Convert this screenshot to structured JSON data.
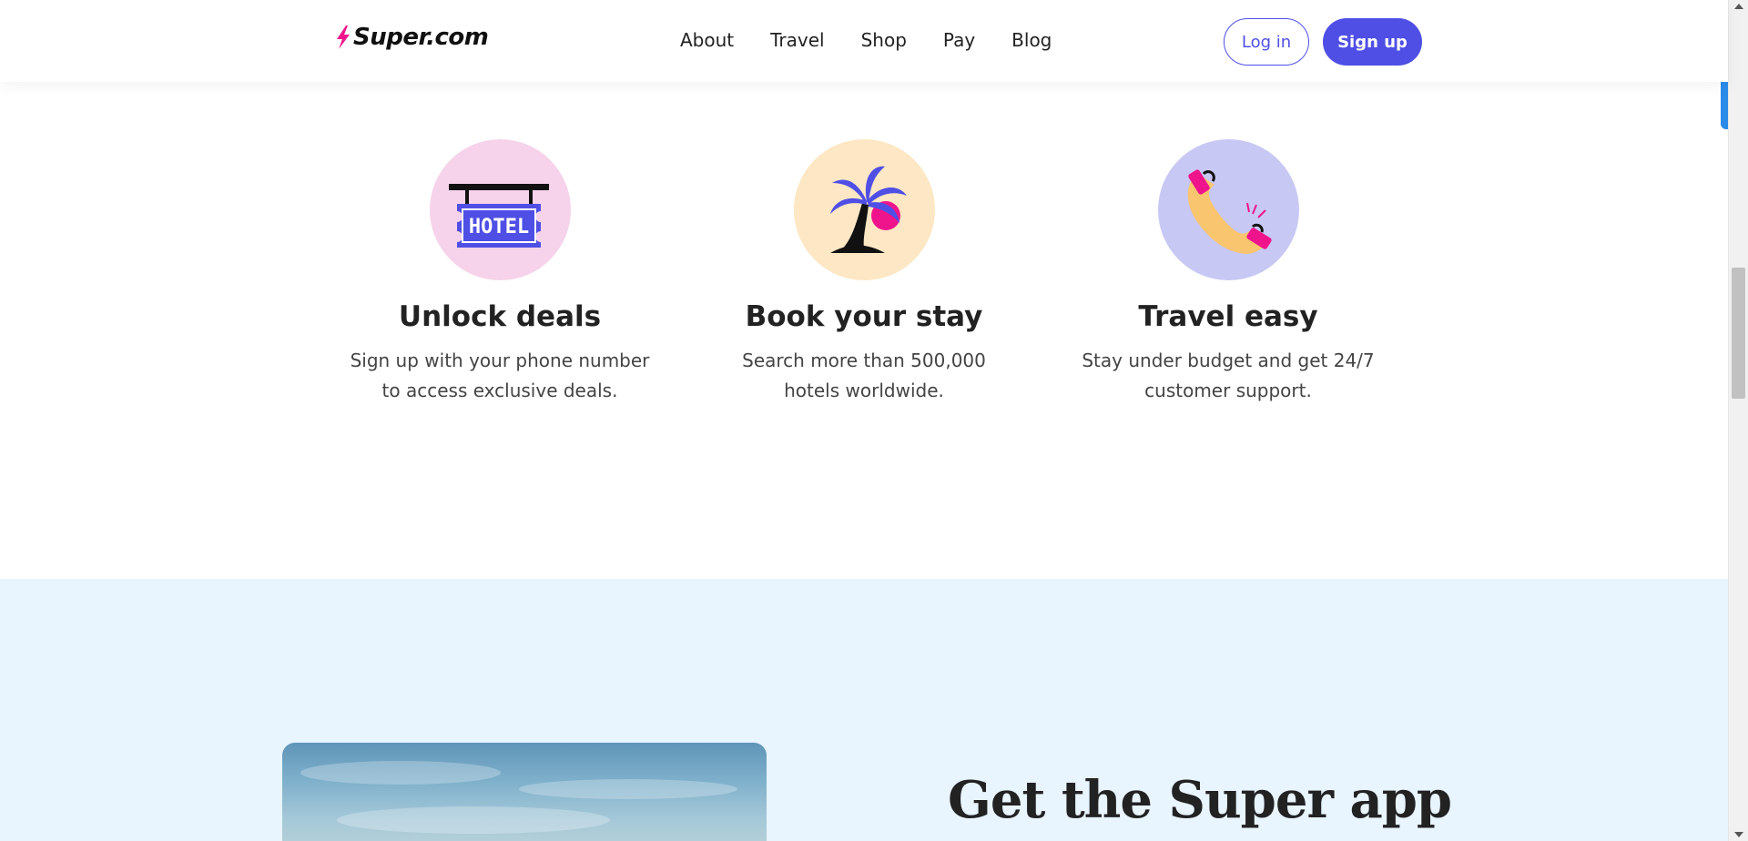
{
  "header": {
    "logo_text": "Super.com",
    "nav": [
      "About",
      "Travel",
      "Shop",
      "Pay",
      "Blog"
    ],
    "login_label": "Log in",
    "signup_label": "Sign up"
  },
  "features": [
    {
      "title": "Unlock deals",
      "desc_line1": "Sign up with your phone number",
      "desc_line2": "to access exclusive deals.",
      "icon": "hotel-sign-icon",
      "icon_text": "HOTEL"
    },
    {
      "title": "Book your stay",
      "desc_line1": "Search more than 500,000",
      "desc_line2": "hotels worldwide.",
      "icon": "palm-tree-icon"
    },
    {
      "title": "Travel easy",
      "desc_line1": "Stay under budget and get 24/7",
      "desc_line2": "customer support.",
      "icon": "phone-icon"
    }
  ],
  "app_section": {
    "title": "Get the Super app"
  },
  "colors": {
    "accent": "#4f4fe6",
    "pink": "#f6d3ea",
    "yellow": "#fde7c4",
    "lavender": "#c8c8f4",
    "hot_pink": "#f0148c",
    "section_bg": "#e8f4fe"
  }
}
